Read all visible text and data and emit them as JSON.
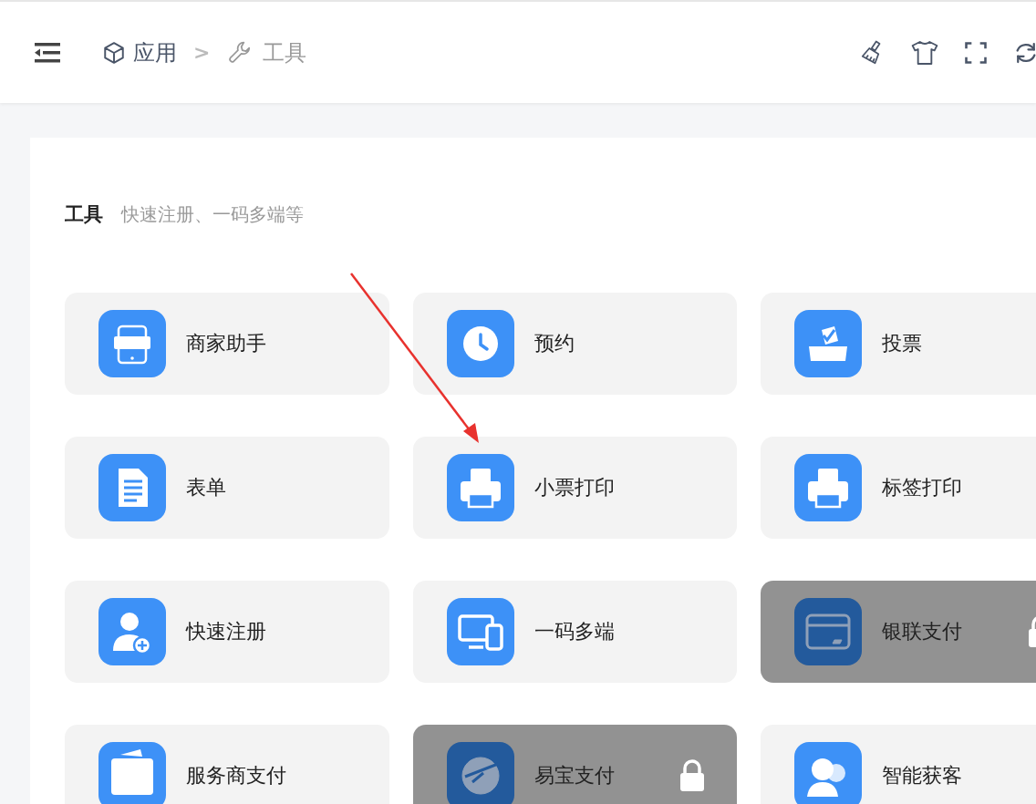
{
  "breadcrumb": [
    {
      "label": "应用"
    },
    {
      "label": "工具"
    }
  ],
  "breadcrumb_separator": ">",
  "section": {
    "title": "工具",
    "subtitle": "快速注册、一码多端等"
  },
  "tools": [
    {
      "label": "商家助手",
      "locked": false
    },
    {
      "label": "预约",
      "locked": false
    },
    {
      "label": "投票",
      "locked": false
    },
    {
      "label": "表单",
      "locked": false
    },
    {
      "label": "小票打印",
      "locked": false
    },
    {
      "label": "标签打印",
      "locked": false
    },
    {
      "label": "快速注册",
      "locked": false
    },
    {
      "label": "一码多端",
      "locked": false
    },
    {
      "label": "银联支付",
      "locked": true
    },
    {
      "label": "服务商支付",
      "locked": false
    },
    {
      "label": "易宝支付",
      "locked": true
    },
    {
      "label": "智能获客",
      "locked": false
    }
  ]
}
